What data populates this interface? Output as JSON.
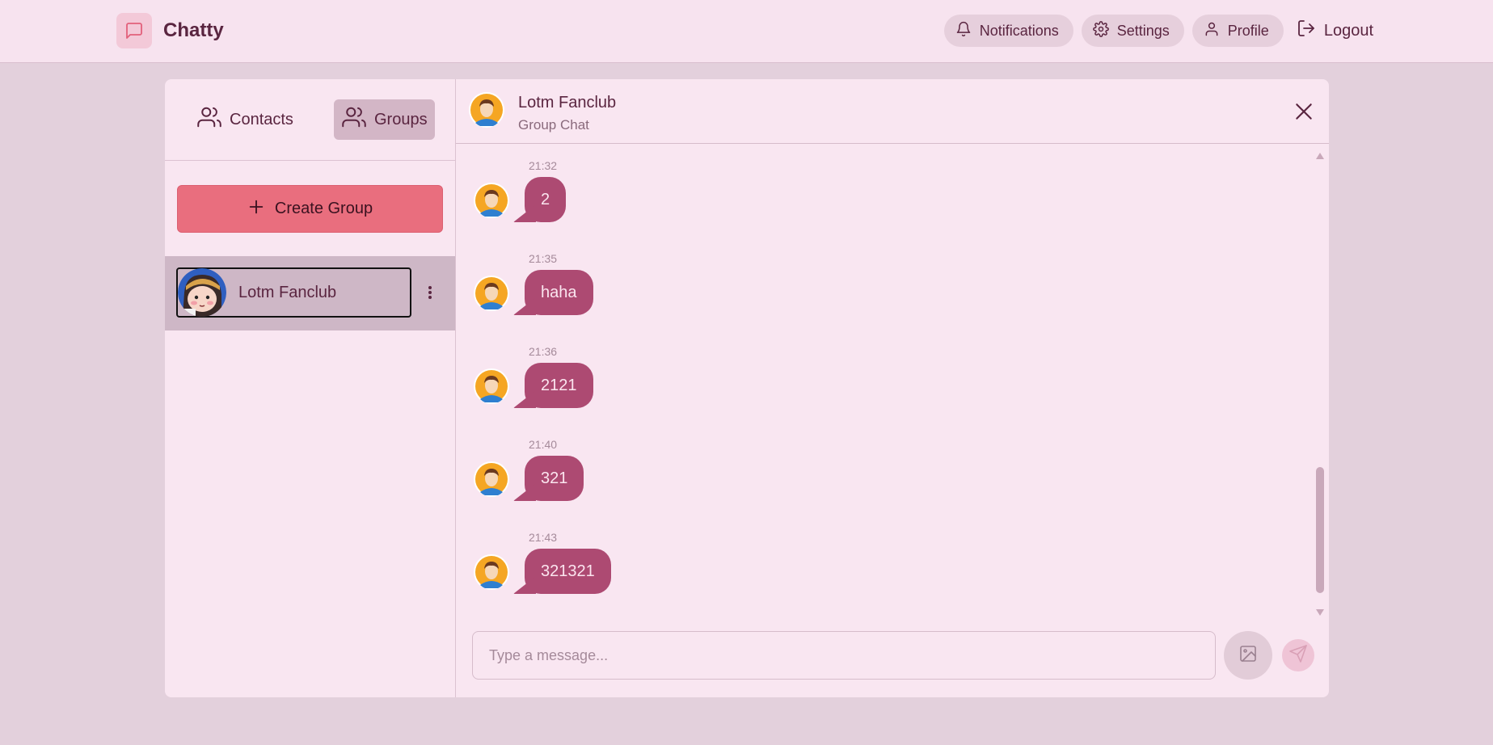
{
  "app": {
    "name": "Chatty"
  },
  "nav": {
    "notifications": "Notifications",
    "settings": "Settings",
    "profile": "Profile",
    "logout": "Logout"
  },
  "sidebar": {
    "tabs": [
      {
        "label": "Contacts",
        "active": false
      },
      {
        "label": "Groups",
        "active": true
      }
    ],
    "create_group": "Create Group",
    "groups": [
      {
        "name": "Lotm Fanclub",
        "selected": true
      }
    ]
  },
  "chat": {
    "title": "Lotm Fanclub",
    "subtitle": "Group Chat",
    "messages": [
      {
        "time": "21:32",
        "text": "2"
      },
      {
        "time": "21:35",
        "text": "haha"
      },
      {
        "time": "21:36",
        "text": "2121"
      },
      {
        "time": "21:40",
        "text": "321"
      },
      {
        "time": "21:43",
        "text": "321321"
      }
    ],
    "input_placeholder": "Type a message..."
  },
  "colors": {
    "accent": "#e96e7e",
    "bubble": "#ad4a72",
    "page_bg": "#e3d0dc",
    "card_bg": "#f9e6f1"
  },
  "icons": [
    "message-square-icon",
    "bell-icon",
    "gear-icon",
    "user-icon",
    "logout-icon",
    "users-icon",
    "plus-icon",
    "more-vertical-icon",
    "close-icon",
    "image-icon",
    "send-icon"
  ]
}
